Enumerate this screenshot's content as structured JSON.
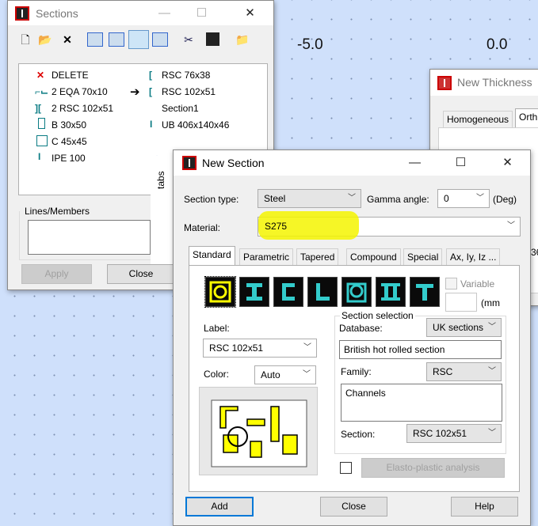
{
  "canvas": {
    "axis_labels": [
      "-5.0",
      "0.0"
    ]
  },
  "sections_window": {
    "title": "Sections",
    "toolbar_icons": [
      "new-icon",
      "open-icon",
      "delete-icon",
      "view1-icon",
      "view2-icon",
      "view3-icon",
      "view4-icon",
      "cut-icon",
      "save-icon",
      "folder-icon"
    ],
    "items_left": [
      "DELETE",
      "2 EQA 70x10",
      "2 RSC 102x51",
      "B 30x50",
      "C 45x45",
      "IPE 100"
    ],
    "items_right": [
      "RSC 76x38",
      "RSC 102x51",
      "Section1",
      "UB 406x140x46"
    ],
    "lines_label": "Lines/Members",
    "apply_label": "Apply",
    "close_label": "Close",
    "tabs_label": "tabs"
  },
  "thickness_window": {
    "title": "New Thickness",
    "tab_homogeneous": "Homogeneous",
    "tab_orth": "Orth"
  },
  "new_section": {
    "title": "New Section",
    "section_type_label": "Section type:",
    "section_type_value": "Steel",
    "gamma_label": "Gamma angle:",
    "gamma_value": "0",
    "gamma_unit": "(Deg)",
    "material_label": "Material:",
    "material_value": "S275",
    "highlight_color": "#f5f500",
    "tabs": [
      "Standard",
      "Parametric",
      "Tapered",
      "Compound",
      "Special",
      "Ax, Iy, Iz ..."
    ],
    "variable_label": "Variable",
    "mm_label": "(mm",
    "label_label": "Label:",
    "label_value": "RSC 102x51",
    "color_label": "Color:",
    "color_value": "Auto",
    "section_selection_label": "Section selection",
    "database_label": "Database:",
    "database_value": "UK sections",
    "database_desc": "British hot rolled section",
    "family_label": "Family:",
    "family_value": "RSC",
    "family_desc": "Channels",
    "section_label": "Section:",
    "section_value": "RSC 102x51",
    "elasto_label": "Elasto-plastic analysis",
    "add_label": "Add",
    "close_label": "Close",
    "help_label": "Help"
  }
}
